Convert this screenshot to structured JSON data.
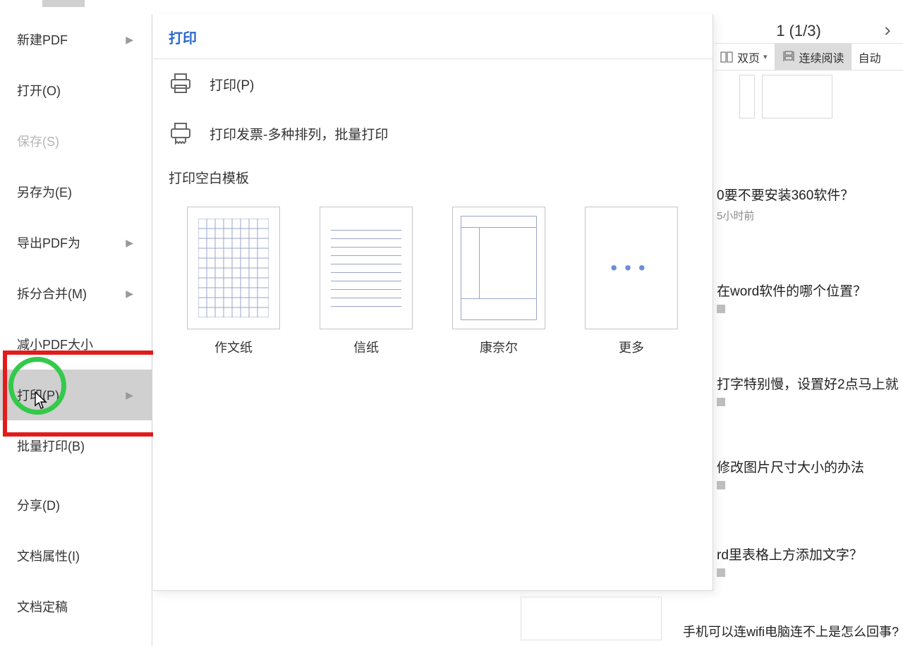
{
  "file_menu": {
    "items": [
      {
        "label": "新建PDF",
        "submenu": true,
        "disabled": false
      },
      {
        "label": "打开(O)",
        "submenu": false,
        "disabled": false
      },
      {
        "label": "保存(S)",
        "submenu": false,
        "disabled": true
      },
      {
        "label": "另存为(E)",
        "submenu": false,
        "disabled": false
      },
      {
        "label": "导出PDF为",
        "submenu": true,
        "disabled": false
      },
      {
        "label": "拆分合并(M)",
        "submenu": true,
        "disabled": false
      },
      {
        "label": "减小PDF大小",
        "submenu": false,
        "disabled": false
      },
      {
        "label": "打印(P)",
        "submenu": true,
        "disabled": false,
        "highlighted": true
      },
      {
        "label": "批量打印(B)",
        "submenu": false,
        "disabled": false
      },
      {
        "label": "分享(D)",
        "submenu": false,
        "disabled": false
      },
      {
        "label": "文档属性(I)",
        "submenu": false,
        "disabled": false
      },
      {
        "label": "文档定稿",
        "submenu": false,
        "disabled": false
      }
    ]
  },
  "print_panel": {
    "title": "打印",
    "option_print": "打印(P)",
    "option_invoice": "打印发票-多种排列，批量打印",
    "blank_templates_label": "打印空白模板",
    "templates": [
      {
        "name": "作文纸"
      },
      {
        "name": "信纸"
      },
      {
        "name": "康奈尔"
      },
      {
        "name": "更多"
      }
    ]
  },
  "topbar": {
    "page_indicator": "1 (1/3)",
    "two_page": "双页",
    "continuous": "连续阅读",
    "auto": "自动"
  },
  "articles": [
    {
      "title": "0要不要安装360软件？",
      "meta": "5小时前"
    },
    {
      "title": "在word软件的哪个位置？"
    },
    {
      "title": "打字特别慢，设置好2点马上就"
    },
    {
      "title": "修改图片尺寸大小的办法"
    },
    {
      "title": "rd里表格上方添加文字？"
    }
  ],
  "bottom_text": "手机可以连wifi电脑连不上是怎么回事?"
}
